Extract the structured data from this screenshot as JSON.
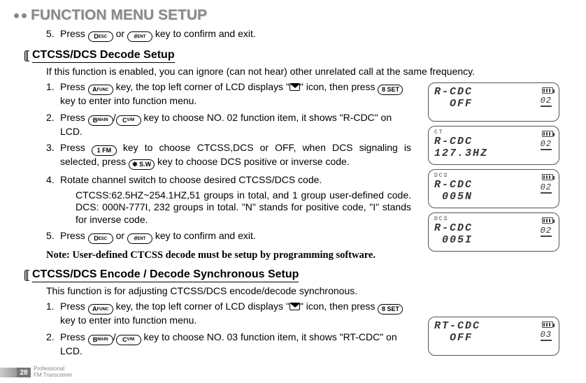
{
  "page_title": "FUNCTION MENU SETUP",
  "page_number": "28",
  "footer_line1": "Professional",
  "footer_line2": "FM Transceiver",
  "top_step5": "key to confirm and exit.",
  "keys": {
    "d": "D",
    "d_sub": "ESC",
    "hash": "#",
    "hash_sub": "ENT",
    "a": "A",
    "a_sub": "FUNC",
    "eight": "8 SET",
    "b": "B",
    "b_sub": "MAIN",
    "c": "C",
    "c_sub": "V/M",
    "one": "1 FM",
    "star": "✱ S.W"
  },
  "sec1": {
    "title": "CTCSS/DCS Decode Setup",
    "intro": "If this function is enabled, you can ignore (can not hear) other unrelated call at the same frequency.",
    "s1a": "key, the top left corner of LCD displays \"",
    "s1b": "\" icon, then press",
    "s1c": "key to enter into function menu.",
    "s2": "key to choose NO. 02 function item, it shows \"R-CDC\" on LCD.",
    "s3a": "key to choose CTCSS,DCS or OFF, when DCS signaling is selected, press",
    "s3b": "key to choose DCS positive or inverse code.",
    "s4": "Rotate channel switch to choose desired CTCSS/DCS code.",
    "s4sub": "CTCSS:62.5HZ~254.1HZ,51 groups in total, and 1 group user-defined code. DCS: 000N-777I, 232 groups in total. \"N\" stands for positive code, \"I\" stands for inverse code.",
    "s5": "key to confirm and exit.",
    "note": "Note: User-defined CTCSS decode must be setup by programming software."
  },
  "sec2": {
    "title": "CTCSS/DCS Encode / Decode Synchronous Setup",
    "intro": "This function is for adjusting CTCSS/DCS encode/decode synchronous.",
    "s1a": "key, the top left corner of LCD displays \"",
    "s1b": "\" icon, then press",
    "s1c": "key to enter into function menu.",
    "s2": "key to choose NO. 03 function item, it shows \"RT-CDC\" on LCD."
  },
  "lcd": [
    {
      "ind": "",
      "line1": "R-CDC",
      "line2": "  OFF",
      "num": "02"
    },
    {
      "ind": "CT",
      "line1": "R-CDC",
      "line2": "127.3HZ",
      "num": "02"
    },
    {
      "ind": "DCS",
      "line1": "R-CDC",
      "line2": " 005N",
      "num": "02"
    },
    {
      "ind": "DCS",
      "line1": "R-CDC",
      "line2": " 005I",
      "num": "02"
    }
  ],
  "lcd_rt": {
    "ind": "",
    "line1": "RT-CDC",
    "line2": "  OFF",
    "num": "03"
  },
  "labels": {
    "press": "Press",
    "or": "or",
    "slash": "/"
  }
}
